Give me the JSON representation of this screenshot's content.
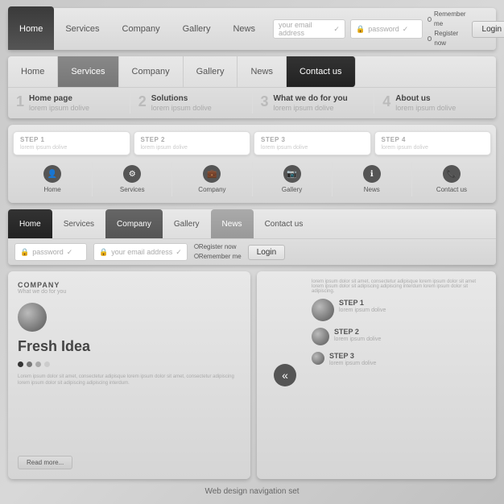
{
  "nav1": {
    "tabs": [
      {
        "label": "Home",
        "active": true
      },
      {
        "label": "Services"
      },
      {
        "label": "Company"
      },
      {
        "label": "Gallery"
      },
      {
        "label": "News"
      }
    ],
    "email_placeholder": "your email address",
    "password_placeholder": "password",
    "login_label": "Login",
    "remember_label": "Remember me",
    "register_label": "Register now"
  },
  "nav2": {
    "tabs": [
      {
        "label": "Home"
      },
      {
        "label": "Services",
        "active": true
      },
      {
        "label": "Company"
      },
      {
        "label": "Gallery"
      },
      {
        "label": "News"
      },
      {
        "label": "Contact us",
        "dark": true
      }
    ],
    "sub_items": [
      {
        "num": "1",
        "title": "Home page",
        "desc": "lorem ipsum dolive"
      },
      {
        "num": "2",
        "title": "Solutions",
        "desc": "lorem ipsum dolive"
      },
      {
        "num": "3",
        "title": "What we do for you",
        "desc": "lorem ipsum dolive"
      },
      {
        "num": "4",
        "title": "About us",
        "desc": "lorem ipsum dolive"
      }
    ]
  },
  "nav3": {
    "steps": [
      {
        "label": "STEP 1",
        "desc": "lorem ipsum dolive"
      },
      {
        "label": "STEP 2",
        "desc": "lorem ipsum dolive"
      },
      {
        "label": "STEP 3",
        "desc": "lorem ipsum dolive"
      },
      {
        "label": "STEP 4",
        "desc": "lorem ipsum dolive"
      }
    ],
    "icons": [
      {
        "label": "Home",
        "icon": "👤"
      },
      {
        "label": "Services",
        "icon": "⚙"
      },
      {
        "label": "Company",
        "icon": "💼"
      },
      {
        "label": "Gallery",
        "icon": "📷"
      },
      {
        "label": "News",
        "icon": "ℹ"
      },
      {
        "label": "Contact us",
        "icon": "📞"
      }
    ]
  },
  "nav4": {
    "tabs": [
      {
        "label": "Home",
        "style": "dark"
      },
      {
        "label": "Services"
      },
      {
        "label": "Company",
        "style": "medium"
      },
      {
        "label": "Gallery"
      },
      {
        "label": "News",
        "style": "light-selected"
      },
      {
        "label": "Contact us"
      }
    ],
    "password_placeholder": "password",
    "email_placeholder": "your email address",
    "register_label": "Register now",
    "remember_label": "Remember me",
    "login_label": "Login"
  },
  "card_left": {
    "company_label": "COMPANY",
    "tagline": "What we do for you",
    "title": "Fresh Idea",
    "body_text": "Lorem ipsum dolor sit amet, consectetur adipisque lorem ipsum dolor sit amet, consectetur adipiscing lorem ipsum dolor sit adipiscing adipiscing interdum.",
    "read_more": "Read more...",
    "dots": [
      {
        "color": "#333"
      },
      {
        "color": "#777"
      },
      {
        "color": "#aaa"
      },
      {
        "color": "#ccc"
      }
    ]
  },
  "card_right": {
    "steps": [
      {
        "label": "STEP 1",
        "desc": "lorem ipsum dolive",
        "size": "large"
      },
      {
        "label": "STEP 2",
        "desc": "lorem ipsum dolive",
        "size": "medium"
      },
      {
        "label": "STEP 3",
        "desc": "lorem ipsum dolive",
        "size": "small"
      }
    ],
    "body_text": "lorem ipsum dolor sit amet, consectetur adipisque lorem ipsum dolor sit amet lorem ipsum dolor sit adipiscing adipiscing interdum lorem ipsum dolor sit adipiscing."
  },
  "caption": "Web design navigation set"
}
